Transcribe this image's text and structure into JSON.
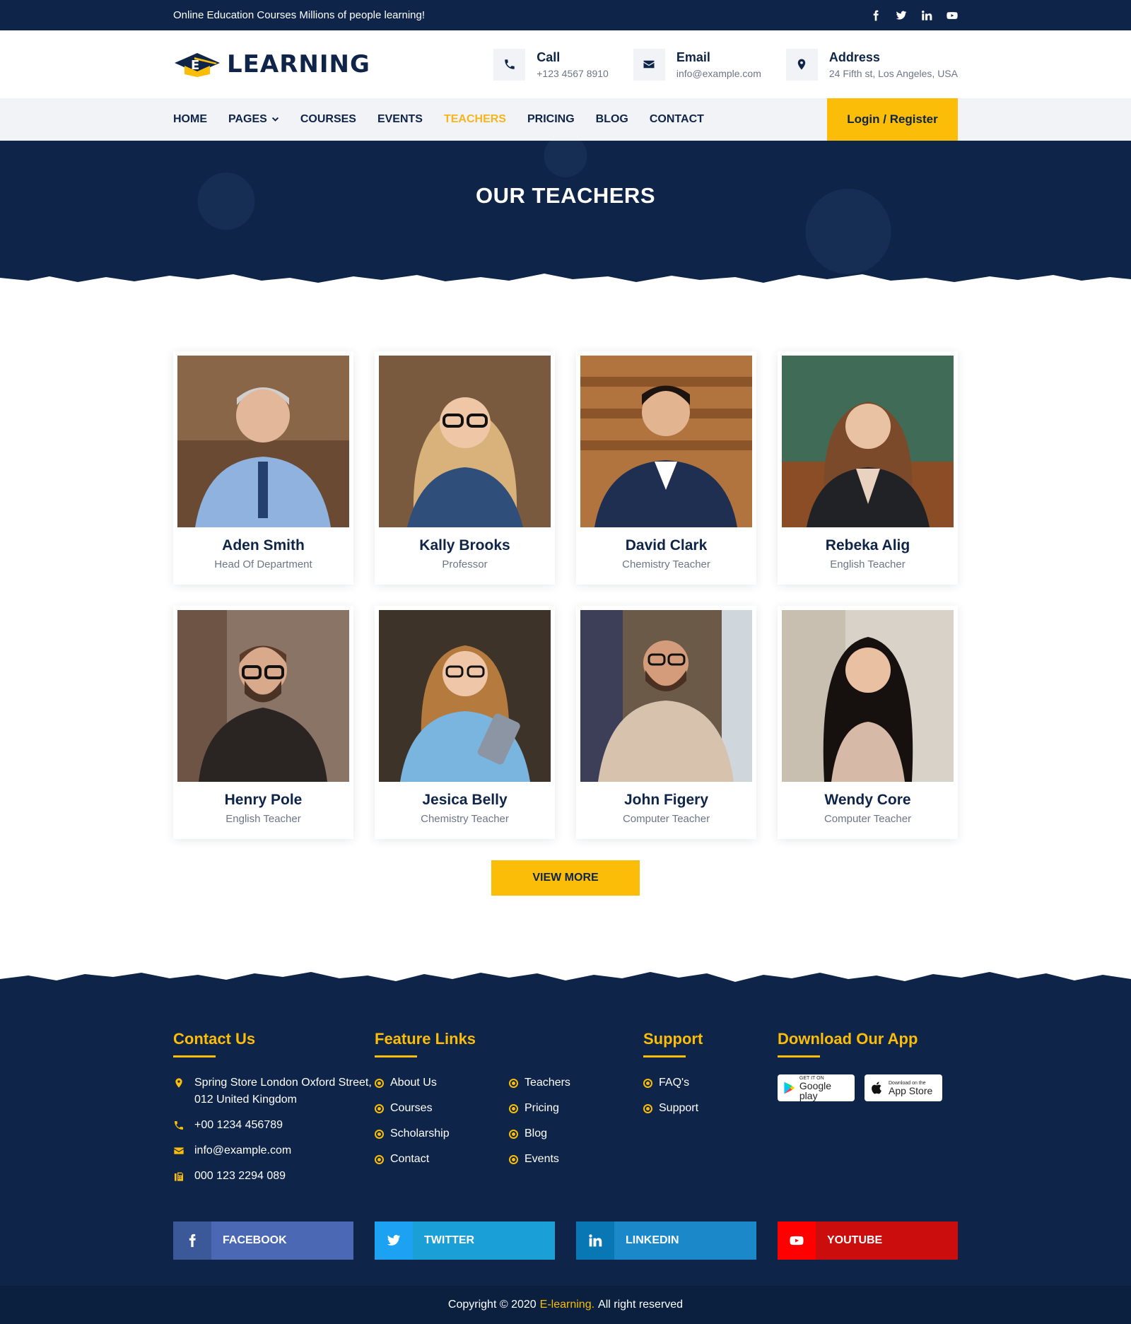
{
  "topbar": {
    "tagline": "Online Education Courses Millions of people learning!"
  },
  "header": {
    "logo_text": "LEARNING",
    "contacts": [
      {
        "title": "Call",
        "value": "+123 4567 8910"
      },
      {
        "title": "Email",
        "value": "info@example.com"
      },
      {
        "title": "Address",
        "value": "24 Fifth st, Los Angeles, USA"
      }
    ]
  },
  "nav": {
    "items": [
      "HOME",
      "PAGES",
      "COURSES",
      "EVENTS",
      "TEACHERS",
      "PRICING",
      "BLOG",
      "CONTACT"
    ],
    "active": "TEACHERS",
    "login_label": "Login / Register"
  },
  "banner": {
    "title": "OUR TEACHERS"
  },
  "teachers": [
    {
      "name": "Aden Smith",
      "role": "Head Of Department"
    },
    {
      "name": "Kally Brooks",
      "role": "Professor"
    },
    {
      "name": "David Clark",
      "role": "Chemistry Teacher"
    },
    {
      "name": "Rebeka Alig",
      "role": "English Teacher"
    },
    {
      "name": "Henry Pole",
      "role": "English Teacher"
    },
    {
      "name": "Jesica Belly",
      "role": "Chemistry Teacher"
    },
    {
      "name": "John Figery",
      "role": "Computer Teacher"
    },
    {
      "name": "Wendy Core",
      "role": "Computer Teacher"
    }
  ],
  "view_more_label": "VIEW MORE",
  "footer": {
    "contact": {
      "heading": "Contact Us",
      "address": "Spring Store London Oxford Street, 012 United Kingdom",
      "phone": "+00 1234 456789",
      "email": "info@example.com",
      "fax": "000 123 2294 089"
    },
    "links": {
      "heading": "Feature Links",
      "col1": [
        "About Us",
        "Courses",
        "Scholarship",
        "Contact"
      ],
      "col2": [
        "Teachers",
        "Pricing",
        "Blog",
        "Events"
      ]
    },
    "support": {
      "heading": "Support",
      "items": [
        "FAQ's",
        "Support"
      ]
    },
    "app": {
      "heading": "Download Our App",
      "google": {
        "small": "GET IT ON",
        "big": "Google play"
      },
      "apple": {
        "small": "Download on the",
        "big": "App Store"
      }
    },
    "social": {
      "facebook": "FACEBOOK",
      "twitter": "TWITTER",
      "linkedin": "LINKEDIN",
      "youtube": "YOUTUBE"
    },
    "copyright": {
      "prefix": "Copyright © 2020",
      "brand": "E-learning.",
      "suffix": "All right reserved"
    }
  },
  "colors": {
    "navy": "#0e2448",
    "yellow": "#fbbd07",
    "active_nav": "#f5b51d"
  }
}
